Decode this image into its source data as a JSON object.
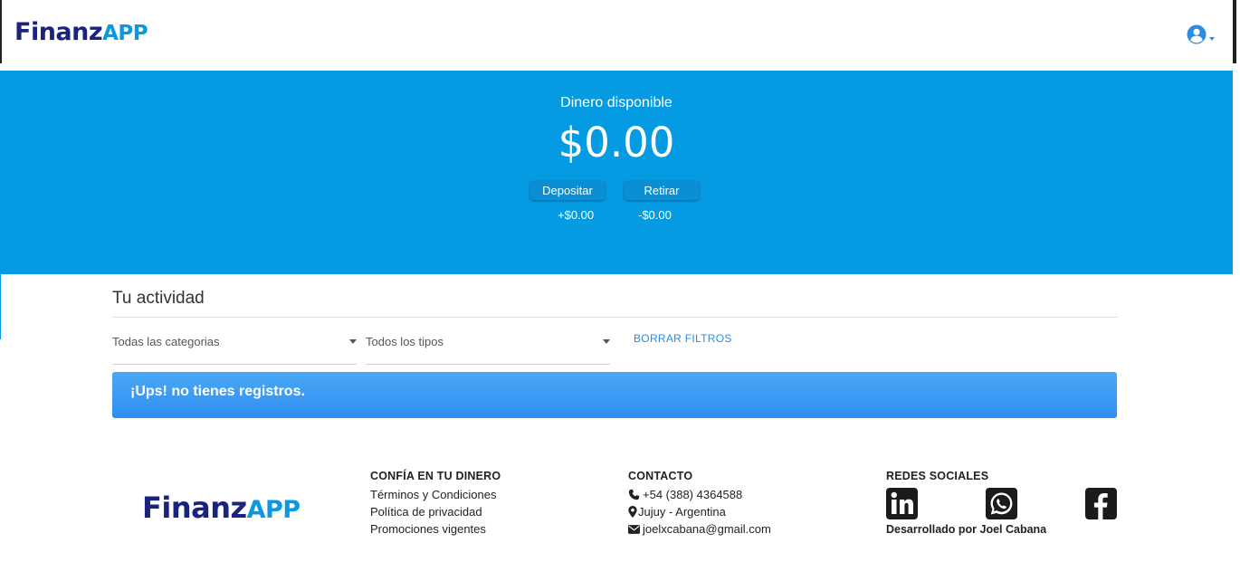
{
  "header": {
    "logo_part1": "Finanz",
    "logo_part2": "app",
    "user_icon": "user-circle-icon"
  },
  "hero": {
    "label": "Dinero disponible",
    "balance": "$0.00",
    "deposit_label": "Depositar",
    "withdraw_label": "Retirar",
    "deposit_total": "+$0.00",
    "withdraw_total": "-$0.00"
  },
  "activity": {
    "title": "Tu actividad",
    "category_select": "Todas las categorias",
    "type_select": "Todos los tipos",
    "clear_filters": "BORRAR FILTROS",
    "empty_message": "¡Ups! no tienes registros."
  },
  "footer": {
    "logo_part1": "Finanz",
    "logo_part2": "app",
    "trust": {
      "heading": "CONFÍA EN TU DINERO",
      "links": [
        "Términos y Condiciones",
        "Política de privacidad",
        "Promociones vigentes"
      ]
    },
    "contact": {
      "heading": "CONTACTO",
      "phone": "+54 (388) 4364588",
      "location": "Jujuy - Argentina",
      "email": "joelxcabana@gmail.com"
    },
    "social": {
      "heading": "REDES SOCIALES",
      "icons": [
        "linkedin-icon",
        "whatsapp-icon",
        "facebook-icon"
      ],
      "credit": "Desarrollado por Joel Cabana"
    }
  },
  "colors": {
    "brand_dark": "#1a237e",
    "brand_light": "#0a98e0",
    "hero_bg": "#059be2",
    "alert_bg": "#3d9cf4",
    "link": "#2a8de2"
  }
}
